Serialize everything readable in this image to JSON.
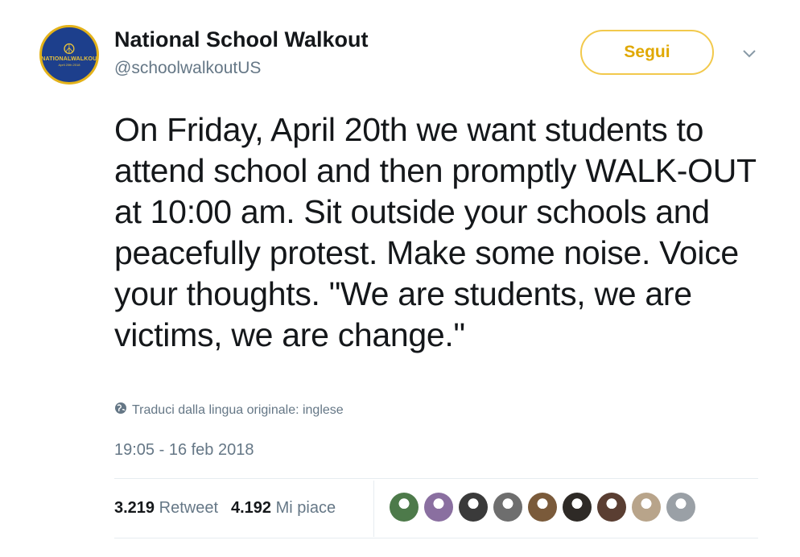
{
  "author": {
    "name": "National School Walkout",
    "handle": "@schoolwalkoutUS",
    "avatar_text": "#NATIONALWALKOUT",
    "avatar_subtext": "April 20th 2018"
  },
  "follow_button": {
    "label": "Segui"
  },
  "tweet": {
    "text": "On Friday, April 20th we want students to attend school and then promptly WALK-OUT at 10:00 am. Sit outside your schools and peacefully protest. Make some noise. Voice your thoughts. \"We are students, we are victims, we are change.\"",
    "translate_label": "Traduci dalla lingua originale: inglese",
    "timestamp": "19:05 - 16 feb 2018"
  },
  "stats": {
    "retweets_count": "3.219",
    "retweets_label": "Retweet",
    "likes_count": "4.192",
    "likes_label": "Mi piace"
  },
  "liker_avatars": [
    {
      "color": "#4d7a4a"
    },
    {
      "color": "#8a6fa0"
    },
    {
      "color": "#3a3a3a"
    },
    {
      "color": "#6e6e6e"
    },
    {
      "color": "#7a5a3a"
    },
    {
      "color": "#2e2a26"
    },
    {
      "color": "#5a3e32"
    },
    {
      "color": "#b8a48a"
    },
    {
      "color": "#9aa0a6"
    }
  ],
  "colors": {
    "follow_accent": "#e0a800",
    "secondary_text": "#657786",
    "primary_text": "#14171a"
  }
}
